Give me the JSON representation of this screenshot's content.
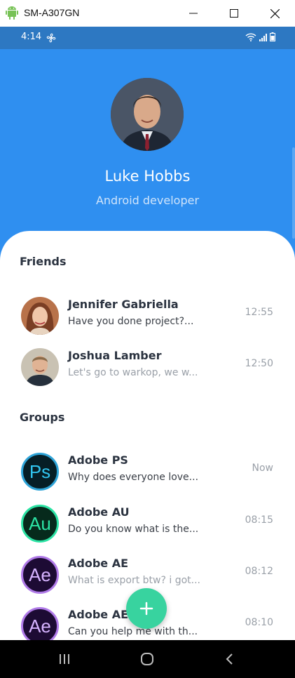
{
  "window": {
    "title": "SM-A307GN"
  },
  "statusbar": {
    "time": "4:14"
  },
  "profile": {
    "name": "Luke Hobbs",
    "role": "Android developer"
  },
  "friends": {
    "title": "Friends",
    "items": [
      {
        "name": "Jennifer Gabriella",
        "message": "Have you done project?...",
        "time": "12:55"
      },
      {
        "name": "Joshua Lamber",
        "message": "Let's go to warkop, we w...",
        "time": "12:50"
      }
    ]
  },
  "groups": {
    "title": "Groups",
    "items": [
      {
        "name": "Adobe PS",
        "icon_text": "Ps",
        "message": "Why does everyone love...",
        "time": "Now"
      },
      {
        "name": "Adobe AU",
        "icon_text": "Au",
        "message": "Do you know what is the...",
        "time": "08:15"
      },
      {
        "name": "Adobe AE",
        "icon_text": "Ae",
        "message": "What is export btw? i got...",
        "time": "08:12"
      },
      {
        "name": "Adobe AE",
        "icon_text": "Ae",
        "message": "Can you help me with th...",
        "time": "08:10"
      }
    ]
  },
  "colors": {
    "header_blue": "#2f8ff0",
    "status_bar": "#2d78c2",
    "fab_green": "#38d39f"
  }
}
